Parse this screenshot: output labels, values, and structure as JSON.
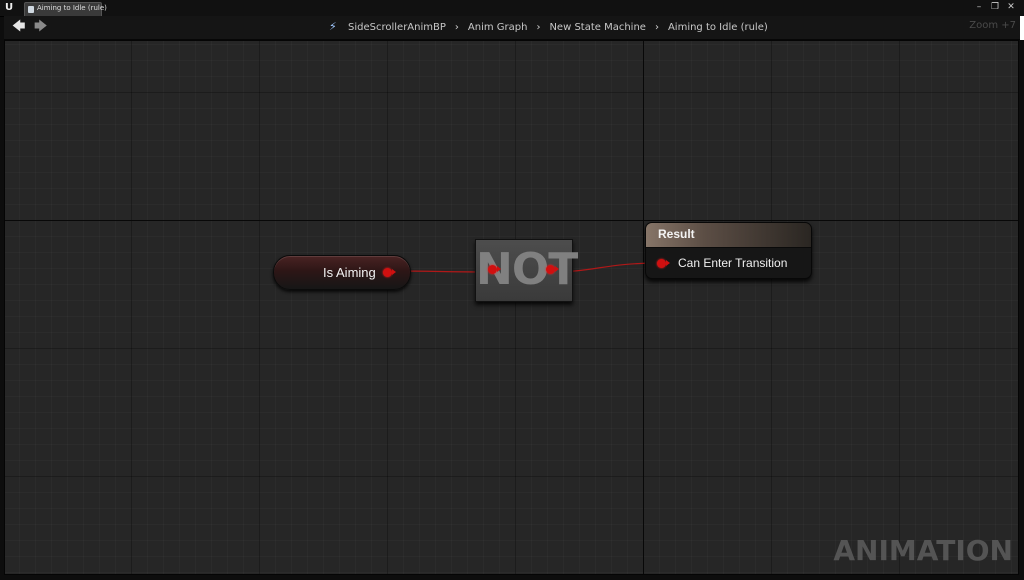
{
  "window": {
    "tab_title": "Aiming to Idle (rule)",
    "tab_close": "×",
    "controls": {
      "minimize": "–",
      "maximize": "❐",
      "close": "✕"
    }
  },
  "toolbar": {
    "back_icon": "arrow-left",
    "forward_icon": "arrow-right",
    "breadcrumb": [
      "SideScrollerAnimBP",
      "Anim Graph",
      "New State Machine",
      "Aiming to Idle (rule)"
    ],
    "zoom": "Zoom +7"
  },
  "graph": {
    "variable_node": {
      "name": "Is Aiming",
      "pin_color": "#d01010"
    },
    "not_node": {
      "label": "NOT"
    },
    "result_node": {
      "title": "Result",
      "pin_label": "Can Enter Transition"
    },
    "watermark": "ANIMATION"
  },
  "colors": {
    "bool_pin": "#d01010",
    "grid_bg": "#262626"
  }
}
